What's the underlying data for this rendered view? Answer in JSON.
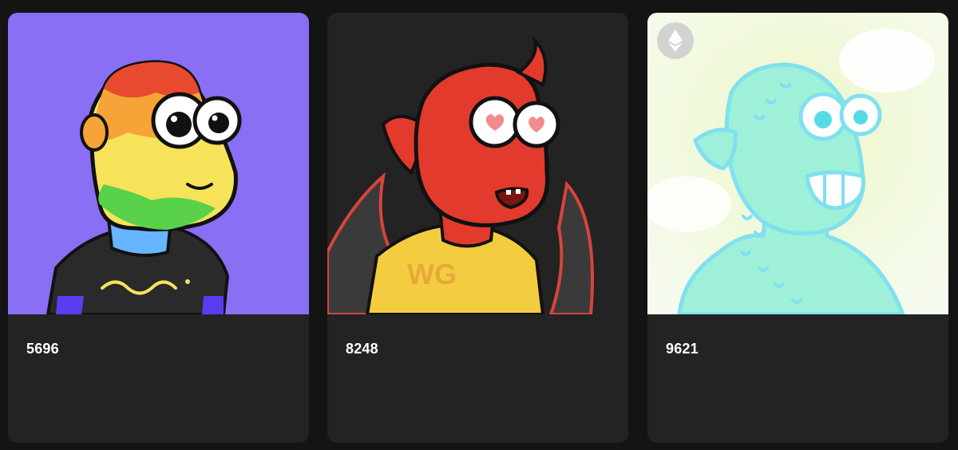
{
  "gallery": {
    "cards": [
      {
        "token_id": "5696",
        "background": "#8a6ef4"
      },
      {
        "token_id": "8248",
        "background": "#232323",
        "shirt_text": "WG"
      },
      {
        "token_id": "9621",
        "background": "#f4fbe6",
        "chain_icon": "ethereum-icon"
      }
    ]
  },
  "colors": {
    "page_background": "#141414",
    "card_background": "#232323",
    "text": "#ffffff"
  }
}
